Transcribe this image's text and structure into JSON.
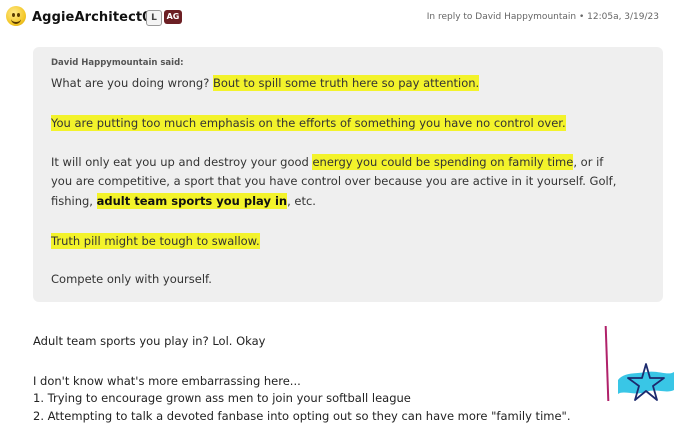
{
  "header": {
    "username": "AggieArchitect04",
    "badge_level": "L",
    "badge_team": "AG",
    "reply_info": "In reply to David Happymountain • 12:05a, 3/19/23"
  },
  "quote": {
    "attribution": "David Happymountain said:",
    "line1_plain": "What are you doing wrong? ",
    "line1_hl": "Bout to spill some truth here so pay attention.",
    "line2_hl": "You are putting too much emphasis on the efforts of something you have no control over.",
    "line3_plain_a": "It will only eat you up and destroy your good ",
    "line3_hl": "energy you could be spending on family time",
    "line3_plain_b": ", or if",
    "line4": "you are competitive, a sport that you have control over because you are active in it yourself. Golf,",
    "line5_plain_a": "fishing, ",
    "line5_bold": "adult team sports you play in",
    "line5_plain_b": ", etc.",
    "line6_hl": "Truth pill might be tough to swallow.",
    "line7": "Compete only with yourself."
  },
  "reply": {
    "line1": "Adult team sports you play in? Lol. Okay",
    "line2": "I don't know what's more embarrassing here...",
    "line3": "1. Trying to encourage grown ass men to join your softball league",
    "line4": "2. Attempting to talk a devoted fanbase into opting out so they can have more \"family time\"."
  },
  "colors": {
    "highlight": "#f3f32b",
    "quote_bg": "#efefef",
    "badge_team_bg": "#6c1f24",
    "doodle_magenta": "#b0216a",
    "doodle_cyan": "#39c6e6",
    "doodle_navy": "#1c2a6e"
  }
}
